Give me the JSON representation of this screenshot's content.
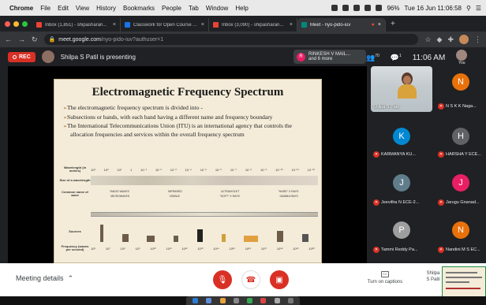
{
  "menubar": {
    "app": "Chrome",
    "items": [
      "File",
      "Edit",
      "View",
      "History",
      "Bookmarks",
      "People",
      "Tab",
      "Window",
      "Help"
    ],
    "battery": "96%",
    "datetime": "Tue 16 Jun  11:06:58"
  },
  "tabs": [
    {
      "label": "Inbox (1,851) - shipasharan...",
      "color": "#ea4335"
    },
    {
      "label": "Classwork for Open Course A...",
      "color": "#1a73e8"
    },
    {
      "label": "Inbox (3,090) - shipasharan...",
      "color": "#ea4335"
    },
    {
      "label": "Meet - nyo-pido-iuv",
      "color": "#00897b"
    }
  ],
  "address": {
    "host": "meet.google.com",
    "path": "/nyo-pido-iuv?authuser=1"
  },
  "meet": {
    "rec_label": "REC",
    "presenting": "Shilpa S Patil is presenting",
    "joined_initial": "R",
    "joined_name": "RINKESH V MAIL...",
    "joined_more": "and 6 more",
    "people_count": "70",
    "chat_count": "1",
    "clock": "11:06 AM",
    "you_label": "You"
  },
  "slide": {
    "title": "Electromagnetic Frequency Spectrum",
    "bullets": [
      "The electromagnetic frequency spectrum is divided into -",
      "Subsections or bands, with each band having a different name and frequency boundary",
      "The International Telecommunications Union (ITU) is an international agency that controls the allocation frequencies and services within the overall frequency spectrum"
    ],
    "row_labels": {
      "wavelength": "Wavelength (in meters)",
      "size": "Size of a wavelength",
      "common_name": "Common name of wave",
      "sources": "Sources",
      "frequency": "Frequency (waves per second)"
    },
    "wavelength_ticks": [
      "10³",
      "10²",
      "10¹",
      "1",
      "10⁻¹",
      "10⁻²",
      "10⁻³",
      "10⁻⁴",
      "10⁻⁵",
      "10⁻⁶",
      "10⁻⁷",
      "10⁻⁸",
      "10⁻⁹",
      "10⁻¹⁰",
      "10⁻¹¹",
      "10⁻¹²"
    ],
    "wave_names_top": [
      "RADIO WAVES",
      "INFRARED",
      "ULTRAVIOLET",
      "\"HARD\" X RAYS"
    ],
    "wave_names_bottom": [
      "MICROWAVES",
      "VISIBLE",
      "\"SOFT\" X RAYS",
      "GAMMA RAYS"
    ],
    "frequency_ticks": [
      "10⁶",
      "10⁷",
      "10⁸",
      "10⁹",
      "10¹⁰",
      "10¹¹",
      "10¹²",
      "10¹³",
      "10¹⁴",
      "10¹⁵",
      "10¹⁶",
      "10¹⁷",
      "10¹⁸",
      "10¹⁹",
      "10²⁰"
    ]
  },
  "participants": [
    {
      "name": "Shilpa S Patil",
      "type": "video"
    },
    {
      "name": "N S K K Naga...",
      "initial": "N",
      "color": "#e8710a"
    },
    {
      "name": "KARMANYA KU...",
      "initial": "K",
      "color": "#0288d1"
    },
    {
      "name": "HARSHA Y ECE...",
      "initial": "H",
      "color": "#5f6368"
    },
    {
      "name": "Jeevitha N ECE-2...",
      "initial": "J",
      "color": "#607d8b"
    },
    {
      "name": "Jarugu Gnanad...",
      "initial": "J",
      "color": "#e91e63"
    },
    {
      "name": "Tammi Reddy Pa...",
      "initial": "P",
      "color": "#9e9e9e"
    },
    {
      "name": "Nandini M S EC...",
      "initial": "N",
      "color": "#e8710a"
    }
  ],
  "bottom": {
    "meeting_details": "Meeting details",
    "captions": "Turn on captions",
    "present": "Shilpa S Patil"
  }
}
